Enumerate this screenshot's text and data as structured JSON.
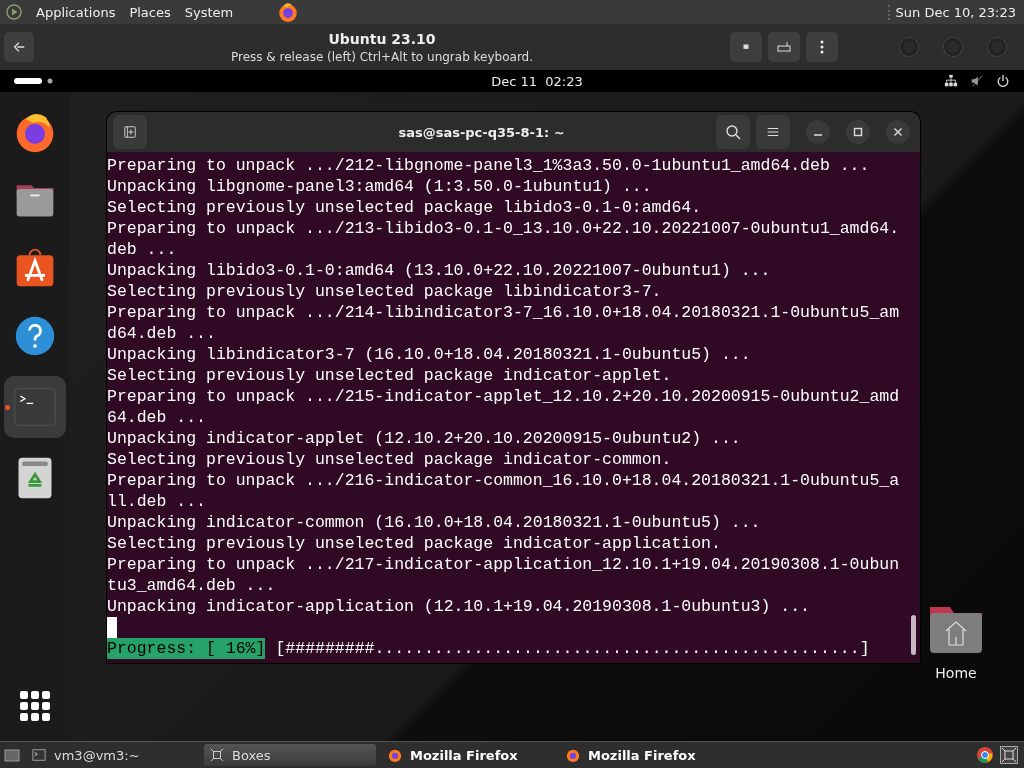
{
  "top_panel": {
    "menus": [
      "Applications",
      "Places",
      "System"
    ],
    "clock": "Sun Dec 10, 23:23"
  },
  "boxes_header": {
    "title": "Ubuntu 23.10",
    "subtitle": "Press & release (left) Ctrl+Alt to ungrab keyboard."
  },
  "gnome_bar": {
    "clock": "Dec 11  02:23"
  },
  "dock": [
    {
      "kind": "firefox",
      "selected": false
    },
    {
      "kind": "files",
      "selected": false
    },
    {
      "kind": "store",
      "selected": false
    },
    {
      "kind": "help",
      "selected": false
    },
    {
      "kind": "terminal",
      "selected": true
    },
    {
      "kind": "trash",
      "selected": false
    }
  ],
  "terminal": {
    "title": "sas@sas-pc-q35-8-1: ~",
    "lines": [
      "Preparing to unpack .../212-libgnome-panel3_1%3a3.50.0-1ubuntu1_amd64.deb ...",
      "Unpacking libgnome-panel3:amd64 (1:3.50.0-1ubuntu1) ...",
      "Selecting previously unselected package libido3-0.1-0:amd64.",
      "Preparing to unpack .../213-libido3-0.1-0_13.10.0+22.10.20221007-0ubuntu1_amd64.",
      "deb ...",
      "Unpacking libido3-0.1-0:amd64 (13.10.0+22.10.20221007-0ubuntu1) ...",
      "Selecting previously unselected package libindicator3-7.",
      "Preparing to unpack .../214-libindicator3-7_16.10.0+18.04.20180321.1-0ubuntu5_am",
      "d64.deb ...",
      "Unpacking libindicator3-7 (16.10.0+18.04.20180321.1-0ubuntu5) ...",
      "Selecting previously unselected package indicator-applet.",
      "Preparing to unpack .../215-indicator-applet_12.10.2+20.10.20200915-0ubuntu2_amd",
      "64.deb ...",
      "Unpacking indicator-applet (12.10.2+20.10.20200915-0ubuntu2) ...",
      "Selecting previously unselected package indicator-common.",
      "Preparing to unpack .../216-indicator-common_16.10.0+18.04.20180321.1-0ubuntu5_a",
      "ll.deb ...",
      "Unpacking indicator-common (16.10.0+18.04.20180321.1-0ubuntu5) ...",
      "Selecting previously unselected package indicator-application.",
      "Preparing to unpack .../217-indicator-application_12.10.1+19.04.20190308.1-0ubun",
      "tu3_amd64.deb ...",
      "Unpacking indicator-application (12.10.1+19.04.20190308.1-0ubuntu3) ..."
    ],
    "progress_label": "Progress: [ 16%]",
    "progress_bar": "[#########.................................................]"
  },
  "desktop_icon": {
    "label": "Home"
  },
  "taskbar": [
    {
      "kind": "terminal",
      "label": "vm3@vm3:~",
      "selected": false
    },
    {
      "kind": "boxes",
      "label": "Boxes",
      "selected": true
    },
    {
      "kind": "firefox",
      "label": "Mozilla Firefox",
      "selected": false
    },
    {
      "kind": "firefox",
      "label": "Mozilla Firefox",
      "selected": false
    }
  ]
}
